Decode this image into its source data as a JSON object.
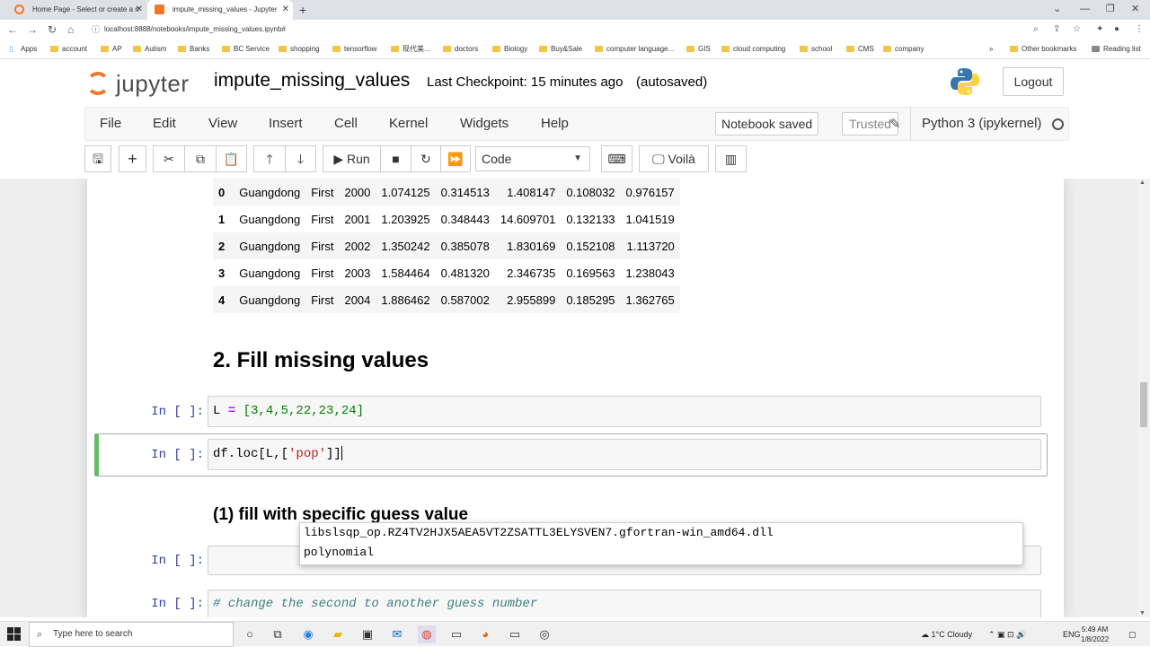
{
  "browser": {
    "tabs": [
      {
        "title": "Home Page - Select or create a n",
        "active": false
      },
      {
        "title": "impute_missing_values - Jupyter",
        "active": true
      }
    ],
    "url": "localhost:8888/notebooks/impute_missing_values.ipynb#",
    "bookmarks": [
      "Apps",
      "account",
      "AP",
      "Autism",
      "Banks",
      "BC Service",
      "shopping",
      "tensorflow",
      "现代美...",
      "doctors",
      "Biology",
      "Buy&Sale",
      "computer language...",
      "GIS",
      "cloud computing",
      "school",
      "CMS",
      "company"
    ],
    "bookmarks_right": [
      "Other bookmarks",
      "Reading list"
    ]
  },
  "jupyter": {
    "logo_text": "jupyter",
    "notebook_title": "impute_missing_values",
    "checkpoint": "Last Checkpoint: 15 minutes ago",
    "autosave": "(autosaved)",
    "logout": "Logout",
    "menus": [
      "File",
      "Edit",
      "View",
      "Insert",
      "Cell",
      "Kernel",
      "Widgets",
      "Help"
    ],
    "notebook_status": "Notebook saved",
    "trusted": "Trusted",
    "kernel": "Python 3 (ipykernel)",
    "toolbar": {
      "run": "Run",
      "cell_type": "Code",
      "voila": "Voilà"
    }
  },
  "dataframe": {
    "rows": [
      [
        "0",
        "Guangdong",
        "First",
        "2000",
        "1.074125",
        "0.314513",
        "1.408147",
        "0.108032",
        "0.976157"
      ],
      [
        "1",
        "Guangdong",
        "First",
        "2001",
        "1.203925",
        "0.348443",
        "14.609701",
        "0.132133",
        "1.041519"
      ],
      [
        "2",
        "Guangdong",
        "First",
        "2002",
        "1.350242",
        "0.385078",
        "1.830169",
        "0.152108",
        "1.113720"
      ],
      [
        "3",
        "Guangdong",
        "First",
        "2003",
        "1.584464",
        "0.481320",
        "2.346735",
        "0.169563",
        "1.238043"
      ],
      [
        "4",
        "Guangdong",
        "First",
        "2004",
        "1.886462",
        "0.587002",
        "2.955899",
        "0.185295",
        "1.362765"
      ]
    ]
  },
  "cells": {
    "heading_fill": "2. Fill missing values",
    "cell1_prompt": "In [ ]:",
    "cell1_code_prefix": "L",
    "cell1_code_op": "=",
    "cell1_code_list": "[3,4,5,22,23,24]",
    "cell2_prompt": "In [ ]:",
    "cell2_code_a": "df.loc[L,[",
    "cell2_code_str": "'pop'",
    "cell2_code_b": "]]",
    "heading_guess": "(1) fill with specific guess value",
    "cell3_prompt": "In [ ]:",
    "cell4_prompt": "In [ ]:",
    "cell4_comment": "# change the second to another guess number"
  },
  "completer": {
    "options": [
      "libslsqp_op.RZ4TV2HJX5AEA5VT2ZSATTL3ELYSVEN7.gfortran-win_amd64.dll",
      "polynomial"
    ]
  },
  "taskbar": {
    "search_placeholder": "Type here to search",
    "weather": "1°C  Cloudy",
    "lang": "ENG",
    "time": "5:49 AM",
    "date": "1/8/2022"
  }
}
